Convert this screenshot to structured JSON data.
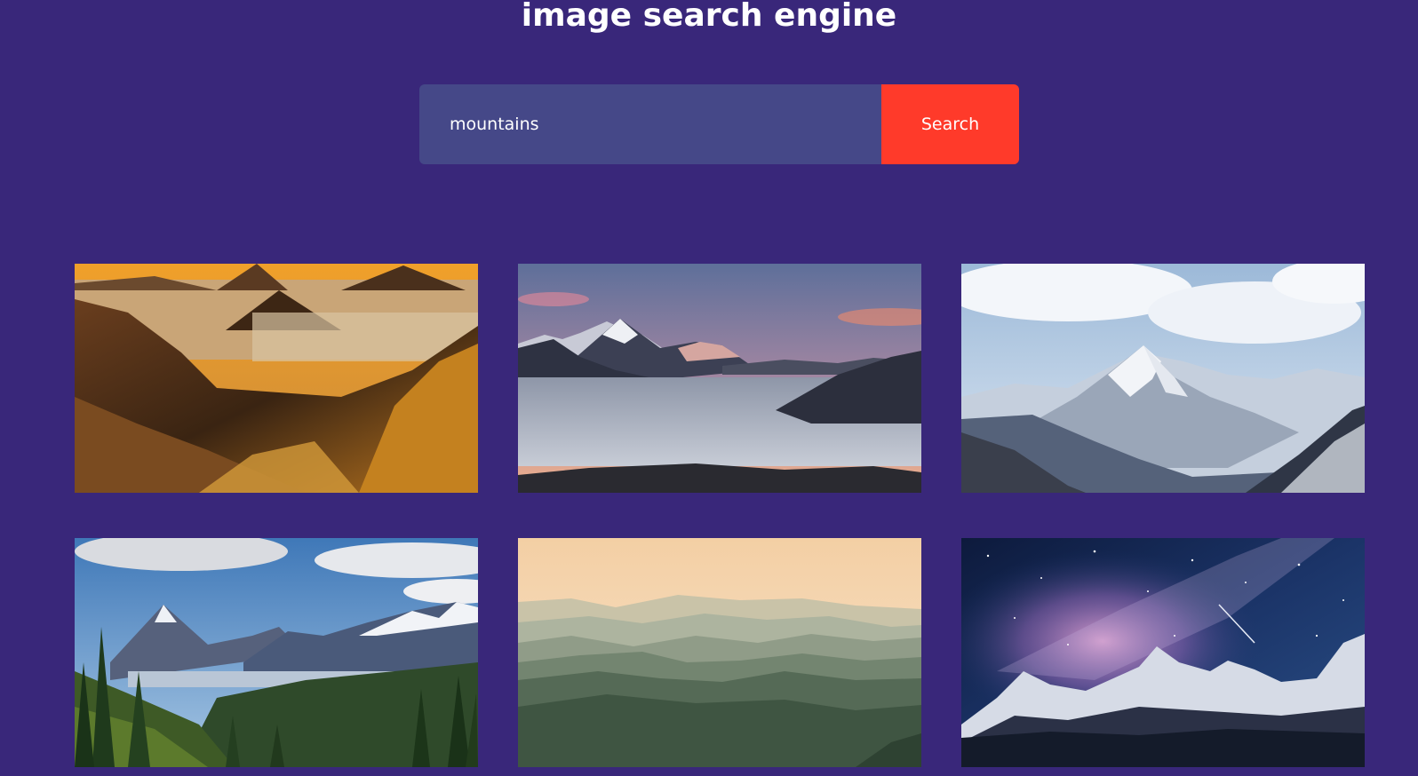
{
  "header": {
    "title": "image search engine"
  },
  "search": {
    "value": "mountains",
    "button_label": "Search"
  },
  "results": [
    {
      "subject": "desert mountains at sunset"
    },
    {
      "subject": "peaks above a sea of clouds"
    },
    {
      "subject": "snowy mountain peak under blue sky"
    },
    {
      "subject": "forest valley with snowy ranges"
    },
    {
      "subject": "misty layered hills"
    },
    {
      "subject": "milky way over snowy peaks"
    }
  ],
  "colors": {
    "background": "#39277a",
    "input_background": "#454888",
    "button_background": "#ff3a2a",
    "text": "#ffffff"
  }
}
